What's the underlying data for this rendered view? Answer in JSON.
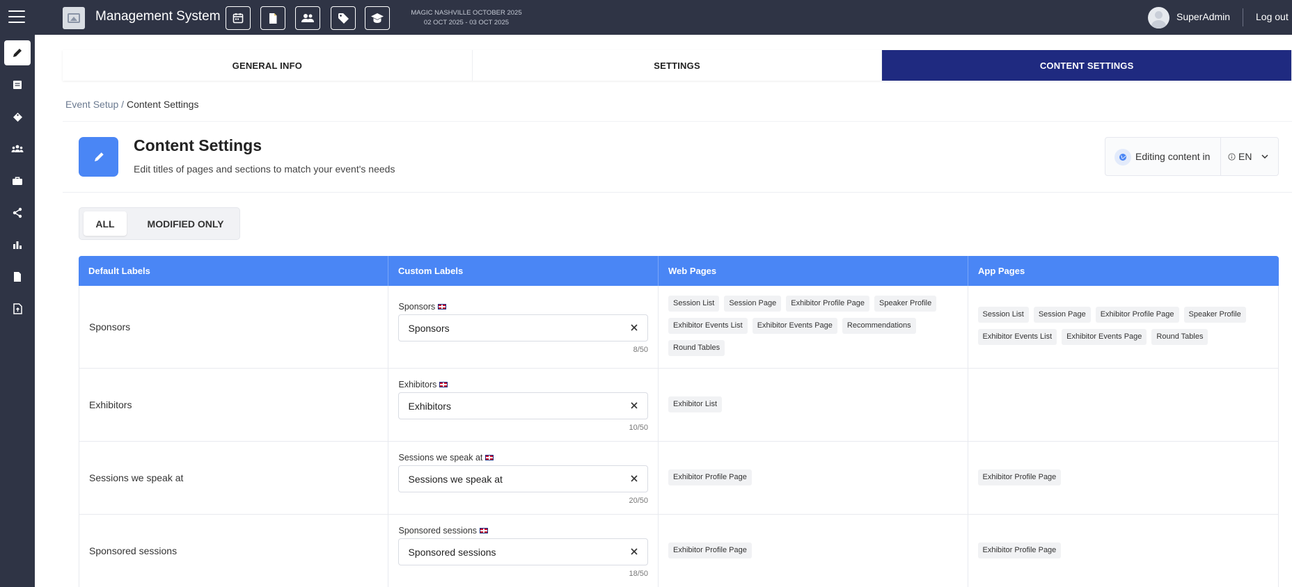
{
  "topbar": {
    "app_title": "Management System",
    "event_name": "MAGIC NASHVILLE OCTOBER 2025",
    "event_dates": "02 OCT 2025 - 03 OCT 2025",
    "username": "SuperAdmin",
    "logout_label": "Log out",
    "quick_icons": [
      "calendar-icon",
      "document-icon",
      "users-icon",
      "tag-icon",
      "graduation-cap-icon"
    ]
  },
  "sidebar": {
    "items": [
      "edit-icon",
      "list-icon",
      "tag-icon",
      "group-icon",
      "briefcase-icon",
      "share-icon",
      "bar-chart-icon",
      "file-icon",
      "file-upload-icon"
    ],
    "active_index": 0
  },
  "tabs": [
    {
      "label": "GENERAL INFO",
      "active": false
    },
    {
      "label": "SETTINGS",
      "active": false
    },
    {
      "label": "CONTENT SETTINGS",
      "active": true
    }
  ],
  "breadcrumb": {
    "parent": "Event Setup",
    "separator": "/",
    "current": "Content Settings"
  },
  "header": {
    "title": "Content Settings",
    "subtitle": "Edit titles of pages and sections to match your event's needs",
    "icon": "pencil-icon"
  },
  "language": {
    "label": "Editing content in",
    "value": "EN"
  },
  "filters": {
    "all_label": "ALL",
    "modified_label": "MODIFIED ONLY",
    "active": "ALL"
  },
  "table": {
    "headers": [
      "Default Labels",
      "Custom Labels",
      "Web Pages",
      "App Pages"
    ],
    "rows": [
      {
        "default_label": "Sponsors",
        "custom_title": "Sponsors",
        "custom_value": "Sponsors",
        "count": "8/50",
        "web_pages": [
          "Session List",
          "Session Page",
          "Exhibitor Profile Page",
          "Speaker Profile",
          "Exhibitor Events List",
          "Exhibitor Events Page",
          "Recommendations",
          "Round Tables"
        ],
        "app_pages": [
          "Session List",
          "Session Page",
          "Exhibitor Profile Page",
          "Speaker Profile",
          "Exhibitor Events List",
          "Exhibitor Events Page",
          "Round Tables"
        ]
      },
      {
        "default_label": "Exhibitors",
        "custom_title": "Exhibitors",
        "custom_value": "Exhibitors",
        "count": "10/50",
        "web_pages": [
          "Exhibitor List"
        ],
        "app_pages": []
      },
      {
        "default_label": "Sessions we speak at",
        "custom_title": "Sessions we speak at",
        "custom_value": "Sessions we speak at",
        "count": "20/50",
        "web_pages": [
          "Exhibitor Profile Page"
        ],
        "app_pages": [
          "Exhibitor Profile Page"
        ]
      },
      {
        "default_label": "Sponsored sessions",
        "custom_title": "Sponsored sessions",
        "custom_value": "Sponsored sessions",
        "count": "18/50",
        "web_pages": [
          "Exhibitor Profile Page"
        ],
        "app_pages": [
          "Exhibitor Profile Page"
        ]
      }
    ]
  },
  "colors": {
    "topbar_bg": "#2f3445",
    "active_tab": "#1f2a80",
    "accent_blue": "#4a86f5"
  }
}
